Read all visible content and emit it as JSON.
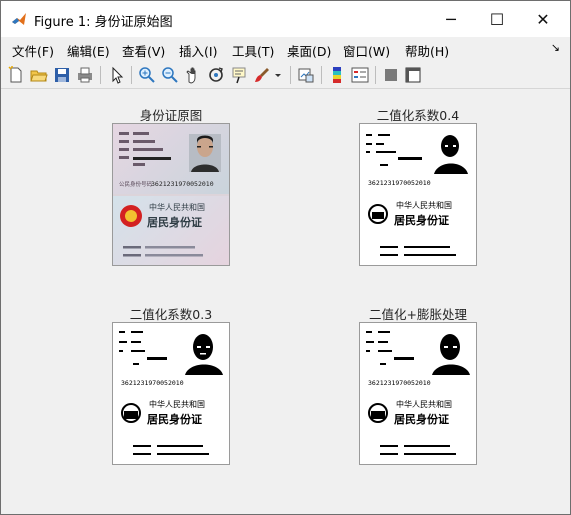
{
  "window": {
    "title": "Figure 1: 身份证原始图",
    "minimize": "─",
    "maximize": "☐",
    "close": "✕"
  },
  "menu": {
    "items": [
      "文件(F)",
      "编辑(E)",
      "查看(V)",
      "插入(I)",
      "工具(T)",
      "桌面(D)",
      "窗口(W)",
      "帮助(H)"
    ],
    "overflow": "↘"
  },
  "toolbar": {
    "buttons": [
      "new-figure-icon",
      "open-file-icon",
      "save-icon",
      "print-icon",
      "pointer-icon",
      "zoom-in-icon",
      "zoom-out-icon",
      "pan-icon",
      "rotate-3d-icon",
      "data-cursor-icon",
      "brush-icon",
      "brush-dropdown-icon",
      "link-plot-icon",
      "colorbar-icon",
      "legend-icon",
      "hide-plot-tools-icon",
      "show-plot-tools-icon"
    ]
  },
  "subplots": [
    {
      "title": "身份证原图",
      "style": "color"
    },
    {
      "title": "二值化系数0.4",
      "style": "binary-light"
    },
    {
      "title": "二值化系数0.3",
      "style": "binary-medium"
    },
    {
      "title": "二值化+膨胀处理",
      "style": "binary-dilated"
    }
  ],
  "card": {
    "front_numbers": "3621231970052010",
    "back_header": "中华人民共和国",
    "back_title": "居民身份证"
  },
  "colors": {
    "titlebar": "#ffffff",
    "background": "#f0f0f0",
    "matlab_orange": "#e2701b"
  }
}
